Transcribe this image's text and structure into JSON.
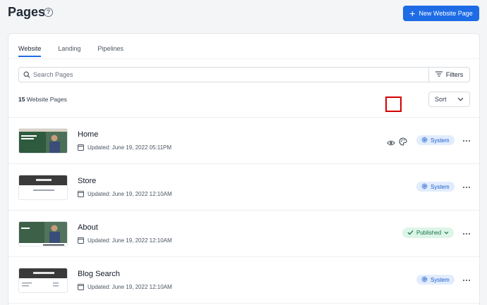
{
  "header": {
    "title": "Pages",
    "help_icon": "question-circle-icon",
    "new_button_label": "New Website Page",
    "accent_color": "#1d6ce6"
  },
  "tabs": [
    {
      "label": "Website",
      "active": true
    },
    {
      "label": "Landing",
      "active": false
    },
    {
      "label": "Pipelines",
      "active": false
    }
  ],
  "search": {
    "placeholder": "Search Pages",
    "value": ""
  },
  "filters_label": "Filters",
  "count": {
    "number": "15",
    "label": "Website Pages"
  },
  "sort_label": "Sort",
  "pages": [
    {
      "title": "Home",
      "updated": "Updated: June 19, 2022 05:11PM",
      "badge": "System",
      "badge_type": "system",
      "has_preview": true,
      "thumb_text": "Let's Get Serious About Your Home"
    },
    {
      "title": "Store",
      "updated": "Updated: June 19, 2022 12:10AM",
      "badge": "System",
      "badge_type": "system",
      "has_preview": false,
      "thumb_text": "The Store"
    },
    {
      "title": "About",
      "updated": "Updated: June 19, 2022 12:10AM",
      "badge": "Published",
      "badge_type": "published",
      "has_preview": false,
      "thumb_text": "About"
    },
    {
      "title": "Blog Search",
      "updated": "Updated: June 19, 2022 12:10AM",
      "badge": "System",
      "badge_type": "system",
      "has_preview": false,
      "thumb_text": "The Home Blog"
    }
  ]
}
